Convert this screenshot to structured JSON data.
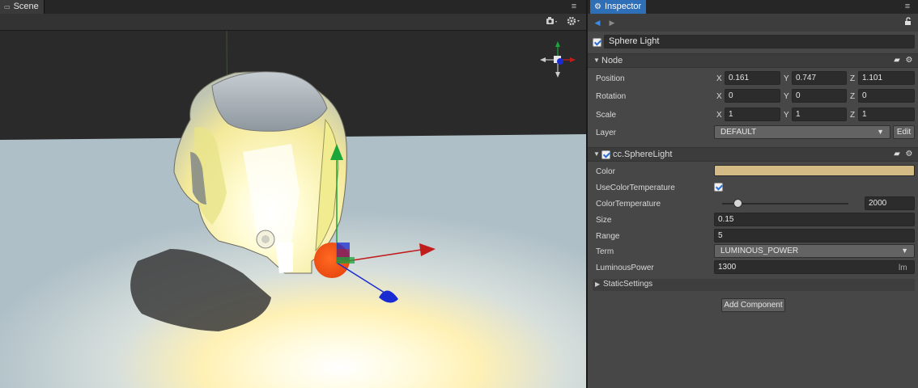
{
  "scene": {
    "tab_label": "Scene",
    "menu_icon": "≡",
    "toolbar": {
      "camera_icon": "camera-icon",
      "settings_icon": "gear-icon"
    }
  },
  "inspector": {
    "tab_label": "Inspector",
    "menu_icon": "≡",
    "node_name": "Sphere Light",
    "node_enabled": true,
    "node_section": {
      "title": "Node",
      "position": {
        "label": "Position",
        "x": "0.161",
        "y": "0.747",
        "z": "1.101"
      },
      "rotation": {
        "label": "Rotation",
        "x": "0",
        "y": "0",
        "z": "0"
      },
      "scale": {
        "label": "Scale",
        "x": "1",
        "y": "1",
        "z": "1"
      },
      "layer": {
        "label": "Layer",
        "value": "DEFAULT",
        "edit_label": "Edit"
      },
      "axis_x": "X",
      "axis_y": "Y",
      "axis_z": "Z"
    },
    "light_section": {
      "title": "cc.SphereLight",
      "enabled": true,
      "color_label": "Color",
      "color_value": "#d4bb86",
      "use_color_temp_label": "UseColorTemperature",
      "use_color_temp": true,
      "color_temp_label": "ColorTemperature",
      "color_temp_value": "2000",
      "color_temp_fraction": 0.12,
      "size_label": "Size",
      "size_value": "0.15",
      "range_label": "Range",
      "range_value": "5",
      "term_label": "Term",
      "term_value": "LUMINOUS_POWER",
      "luminous_label": "LuminousPower",
      "luminous_value": "1300",
      "luminous_unit": "lm"
    },
    "static_settings_label": "StaticSettings",
    "add_component_label": "Add Component"
  },
  "colors": {
    "accent": "#2f6fb8",
    "gizmo_x": "#c21d1d",
    "gizmo_y": "#1aa63a",
    "gizmo_z": "#1a2bd1",
    "light_sphere": "#f2571a"
  }
}
